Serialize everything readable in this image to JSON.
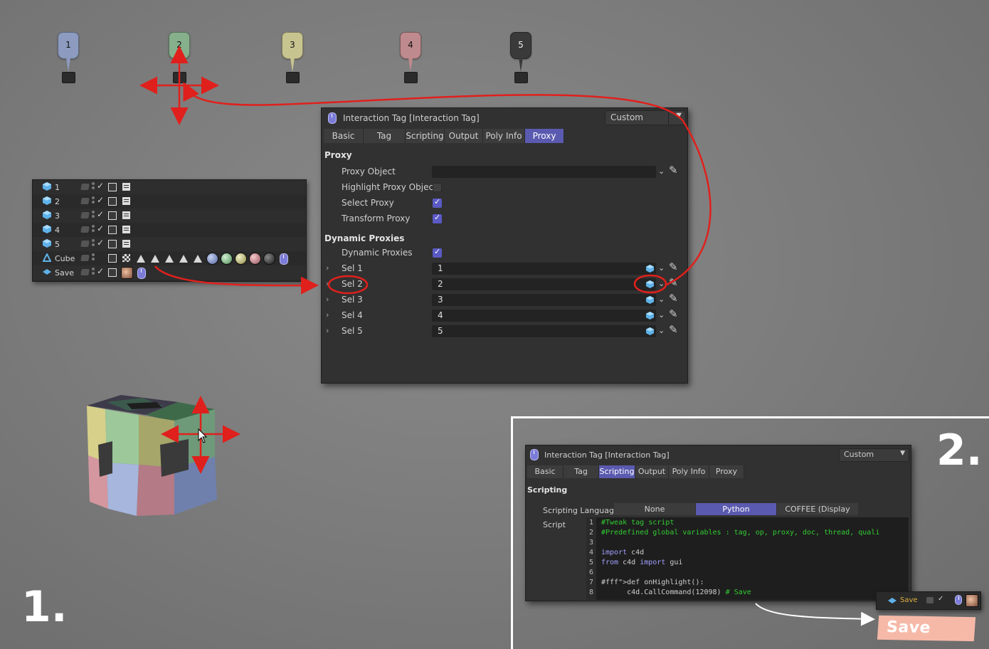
{
  "markers": [
    {
      "label": "1",
      "color": "#8c9bbf",
      "stem": "#8c9bbf"
    },
    {
      "label": "2",
      "color": "#86b08c",
      "stem": "#86b08c"
    },
    {
      "label": "3",
      "color": "#c8c490",
      "stem": "#c8c490"
    },
    {
      "label": "4",
      "color": "#bf8a8e",
      "stem": "#bf8a8e"
    },
    {
      "label": "5",
      "color": "#3a3a3a",
      "stem": "#3a3a3a"
    }
  ],
  "object_manager": {
    "rows": [
      {
        "name": "1"
      },
      {
        "name": "2"
      },
      {
        "name": "3"
      },
      {
        "name": "4"
      },
      {
        "name": "5"
      },
      {
        "name": "Cube"
      },
      {
        "name": "Save"
      }
    ]
  },
  "panel": {
    "title": "Interaction Tag [Interaction Tag]",
    "mode": "Custom",
    "tabs": [
      "Basic",
      "Tag",
      "Scripting",
      "Output",
      "Poly Info",
      "Proxy"
    ],
    "active_tab": "Proxy",
    "section_proxy": "Proxy",
    "proxy_object_label": "Proxy Object",
    "highlight_label": "Highlight Proxy Object",
    "select_label": "Select Proxy",
    "transform_label": "Transform Proxy",
    "section_dynamic": "Dynamic Proxies",
    "dynamic_label": "Dynamic Proxies",
    "sels": [
      {
        "label": "Sel 1",
        "value": "1"
      },
      {
        "label": "Sel 2",
        "value": "2"
      },
      {
        "label": "Sel 3",
        "value": "3"
      },
      {
        "label": "Sel 4",
        "value": "4"
      },
      {
        "label": "Sel 5",
        "value": "5"
      }
    ]
  },
  "panel2": {
    "title": "Interaction Tag [Interaction Tag]",
    "mode": "Custom",
    "tabs": [
      "Basic",
      "Tag",
      "Scripting",
      "Output",
      "Poly Info",
      "Proxy"
    ],
    "active_tab": "Scripting",
    "section": "Scripting",
    "lang_label": "Scripting Language",
    "lang_options": [
      "None",
      "Python",
      "COFFEE (Display Only)"
    ],
    "lang_selected": "Python",
    "script_label": "Script",
    "code_lines": [
      {
        "n": "1",
        "text": "#Tweak tag script",
        "kind": "comment"
      },
      {
        "n": "2",
        "text": "#Predefined global variables : tag, op, proxy, doc, thread, quali",
        "kind": "comment"
      },
      {
        "n": "3",
        "text": "",
        "kind": "plain"
      },
      {
        "n": "4",
        "text": "import c4d",
        "kind": "import"
      },
      {
        "n": "5",
        "text": "from c4d import gui",
        "kind": "from"
      },
      {
        "n": "6",
        "text": "",
        "kind": "plain"
      },
      {
        "n": "7",
        "text": "def onHighlight():",
        "kind": "def"
      },
      {
        "n": "8",
        "text": "      c4d.CallCommand(12098) # Save",
        "kind": "call"
      }
    ]
  },
  "mini_om": {
    "name": "Save"
  },
  "save_button": "Save",
  "step1": "1.",
  "step2": "2."
}
